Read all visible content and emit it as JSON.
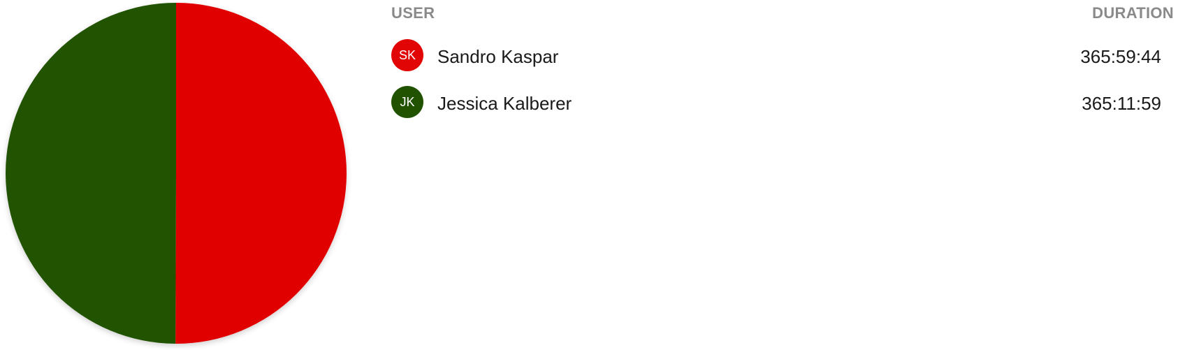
{
  "table": {
    "header_user": "USER",
    "header_duration": "DURATION",
    "rows": [
      {
        "initials": "SK",
        "name": "Sandro Kaspar",
        "duration": "365:59:44",
        "color": "#e10505"
      },
      {
        "initials": "JK",
        "name": "Jessica Kalberer",
        "duration": "365:11:59",
        "color": "#215200"
      }
    ]
  },
  "chart_data": {
    "type": "pie",
    "slices": [
      {
        "initials": "SK",
        "value": 1317584,
        "color": "#e10505"
      },
      {
        "initials": "JK",
        "value": 1314719,
        "color": "#215200"
      }
    ]
  }
}
